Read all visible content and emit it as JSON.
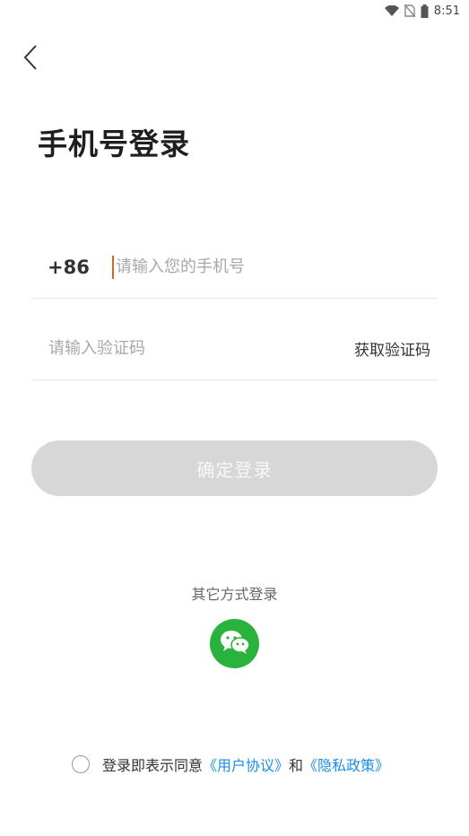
{
  "status_bar": {
    "time": "8:51"
  },
  "header": {
    "title": "手机号登录"
  },
  "phone": {
    "country_code": "+86",
    "placeholder": "请输入您的手机号",
    "value": ""
  },
  "code": {
    "placeholder": "请输入验证码",
    "value": "",
    "get_code_label": "获取验证码"
  },
  "login_button": {
    "label": "确定登录",
    "enabled": false
  },
  "other_login": {
    "label": "其它方式登录",
    "wechat_icon": "wechat-icon",
    "wechat_color": "#2ab33c"
  },
  "agreement": {
    "prefix": "登录即表示同意",
    "user_agreement": "《用户协议》",
    "and": "和",
    "privacy_policy": "《隐私政策》",
    "checked": false,
    "link_color": "#1a8ee6"
  }
}
